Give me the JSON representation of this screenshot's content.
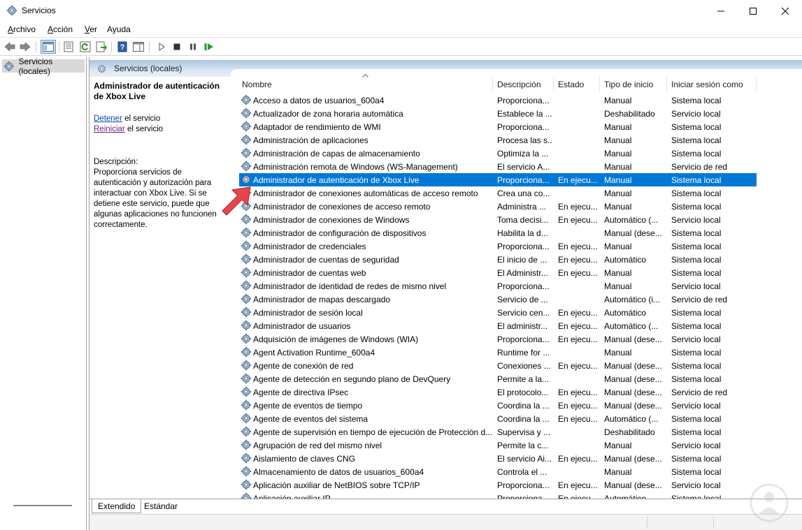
{
  "window": {
    "title": "Servicios",
    "controls": [
      "minimize",
      "maximize",
      "close"
    ]
  },
  "menu": {
    "items": [
      {
        "label": "Archivo",
        "mnemonic": "A",
        "rest": "rchivo"
      },
      {
        "label": "Acción",
        "mnemonic": "A",
        "rest": "cción"
      },
      {
        "label": "Ver",
        "mnemonic": "V",
        "rest": "er"
      },
      {
        "label": "Ayuda",
        "mnemonic": "y",
        "rest": "uda"
      }
    ]
  },
  "toolbar": {
    "icons": [
      "back-icon",
      "forward-icon",
      "show-hide-console-tree-icon",
      "properties-icon",
      "refresh-icon",
      "export-list-icon",
      "help-icon",
      "show-action-pane-icon",
      "play-icon",
      "stop-icon",
      "pause-icon",
      "restart-icon"
    ]
  },
  "tree": {
    "item_label": "Servicios (locales)"
  },
  "panel": {
    "header_label": "Servicios (locales)",
    "extended": {
      "title": "Administrador de autenticación de Xbox Live",
      "stop_link": "Detener",
      "stop_suffix": " el servicio",
      "restart_link": "Reiniciar",
      "restart_suffix": " el servicio",
      "desc_label": "Descripción:",
      "desc_text": "Proporciona servicios de autenticación y autorización para interactuar con Xbox Live. Si se detiene este servicio, puede que algunas aplicaciones no funcionen correctamente."
    },
    "columns": {
      "name": "Nombre",
      "description": "Descripción",
      "state": "Estado",
      "startup": "Tipo de inicio",
      "logon": "Iniciar sesión como"
    },
    "rows": [
      {
        "name": "Acceso a datos de usuarios_600a4",
        "desc": "Proporciona...",
        "state": "",
        "start": "Manual",
        "login": "Sistema local"
      },
      {
        "name": "Actualizador de zona horaria automática",
        "desc": "Establece la ...",
        "state": "",
        "start": "Deshabilitado",
        "login": "Servicio local"
      },
      {
        "name": "Adaptador de rendimiento de WMI",
        "desc": "Proporciona...",
        "state": "",
        "start": "Manual",
        "login": "Sistema local"
      },
      {
        "name": "Administración de aplicaciones",
        "desc": "Procesa las s...",
        "state": "",
        "start": "Manual",
        "login": "Sistema local"
      },
      {
        "name": "Administración de capas de almacenamiento",
        "desc": "Optimiza la ...",
        "state": "",
        "start": "Manual",
        "login": "Sistema local"
      },
      {
        "name": "Administración remota de Windows (WS-Management)",
        "desc": "El servicio A...",
        "state": "",
        "start": "Manual",
        "login": "Servicio de red"
      },
      {
        "name": "Administrador de autenticación de Xbox Live",
        "desc": "Proporciona...",
        "state": "En ejecu...",
        "start": "Manual",
        "login": "Sistema local",
        "selected": true
      },
      {
        "name": "Administrador de conexiones automáticas de acceso remoto",
        "desc": "Crea una co...",
        "state": "",
        "start": "Manual",
        "login": "Sistema local"
      },
      {
        "name": "Administrador de conexiones de acceso remoto",
        "desc": "Administra ...",
        "state": "En ejecu...",
        "start": "Manual",
        "login": "Sistema local"
      },
      {
        "name": "Administrador de conexiones de Windows",
        "desc": "Toma decisi...",
        "state": "En ejecu...",
        "start": "Automático (...",
        "login": "Servicio local"
      },
      {
        "name": "Administrador de configuración de dispositivos",
        "desc": "Habilita la d...",
        "state": "",
        "start": "Manual (dese...",
        "login": "Sistema local"
      },
      {
        "name": "Administrador de credenciales",
        "desc": "Proporciona...",
        "state": "En ejecu...",
        "start": "Manual",
        "login": "Sistema local"
      },
      {
        "name": "Administrador de cuentas de seguridad",
        "desc": "El inicio de ...",
        "state": "En ejecu...",
        "start": "Automático",
        "login": "Sistema local"
      },
      {
        "name": "Administrador de cuentas web",
        "desc": "El Administr...",
        "state": "En ejecu...",
        "start": "Manual",
        "login": "Sistema local"
      },
      {
        "name": "Administrador de identidad de redes de mismo nivel",
        "desc": "Proporciona...",
        "state": "",
        "start": "Manual",
        "login": "Servicio local"
      },
      {
        "name": "Administrador de mapas descargado",
        "desc": "Servicio de ...",
        "state": "",
        "start": "Automático (i...",
        "login": "Servicio de red"
      },
      {
        "name": "Administrador de sesión local",
        "desc": "Servicio cen...",
        "state": "En ejecu...",
        "start": "Automático",
        "login": "Sistema local"
      },
      {
        "name": "Administrador de usuarios",
        "desc": "El administr...",
        "state": "En ejecu...",
        "start": "Automático (...",
        "login": "Sistema local"
      },
      {
        "name": "Adquisición de imágenes de Windows (WIA)",
        "desc": "Proporciona...",
        "state": "En ejecu...",
        "start": "Manual (dese...",
        "login": "Servicio local"
      },
      {
        "name": "Agent Activation Runtime_600a4",
        "desc": "Runtime for ...",
        "state": "",
        "start": "Manual",
        "login": "Sistema local"
      },
      {
        "name": "Agente de conexión de red",
        "desc": "Conexiones ...",
        "state": "En ejecu...",
        "start": "Manual (dese...",
        "login": "Sistema local"
      },
      {
        "name": "Agente de detección en segundo plano de DevQuery",
        "desc": "Permite a la...",
        "state": "",
        "start": "Manual (dese...",
        "login": "Sistema local"
      },
      {
        "name": "Agente de directiva IPsec",
        "desc": "El protocolo...",
        "state": "En ejecu...",
        "start": "Manual (dese...",
        "login": "Servicio de red"
      },
      {
        "name": "Agente de eventos de tiempo",
        "desc": "Coordina la ...",
        "state": "En ejecu...",
        "start": "Manual (dese...",
        "login": "Servicio local"
      },
      {
        "name": "Agente de eventos del sistema",
        "desc": "Coordina la ...",
        "state": "En ejecu...",
        "start": "Automático (...",
        "login": "Sistema local"
      },
      {
        "name": "Agente de supervisión en tiempo de ejecución de Protección d...",
        "desc": "Supervisa y ...",
        "state": "",
        "start": "Deshabilitado",
        "login": "Sistema local"
      },
      {
        "name": "Agrupación de red del mismo nivel",
        "desc": "Permite la c...",
        "state": "",
        "start": "Manual",
        "login": "Servicio local"
      },
      {
        "name": "Aislamiento de claves CNG",
        "desc": "El servicio Ai...",
        "state": "En ejecu...",
        "start": "Manual (dese...",
        "login": "Sistema local"
      },
      {
        "name": "Almacenamiento de datos de usuarios_600a4",
        "desc": "Controla el ...",
        "state": "",
        "start": "Manual",
        "login": "Sistema local"
      },
      {
        "name": "Aplicación auxiliar de NetBIOS sobre TCP/IP",
        "desc": "Proporciona...",
        "state": "En ejecu...",
        "start": "Manual (dese...",
        "login": "Servicio local"
      },
      {
        "name": "Aplicación auxiliar IP",
        "desc": "Proporciona...",
        "state": "En ejecu...",
        "start": "Automático",
        "login": "Sistema local"
      }
    ],
    "tabs": [
      "Extendido",
      "Estándar"
    ]
  },
  "colors": {
    "selection": "#0078d7",
    "annotation_arrow": "#e8454a",
    "header_gradient": "#a9c3df"
  }
}
